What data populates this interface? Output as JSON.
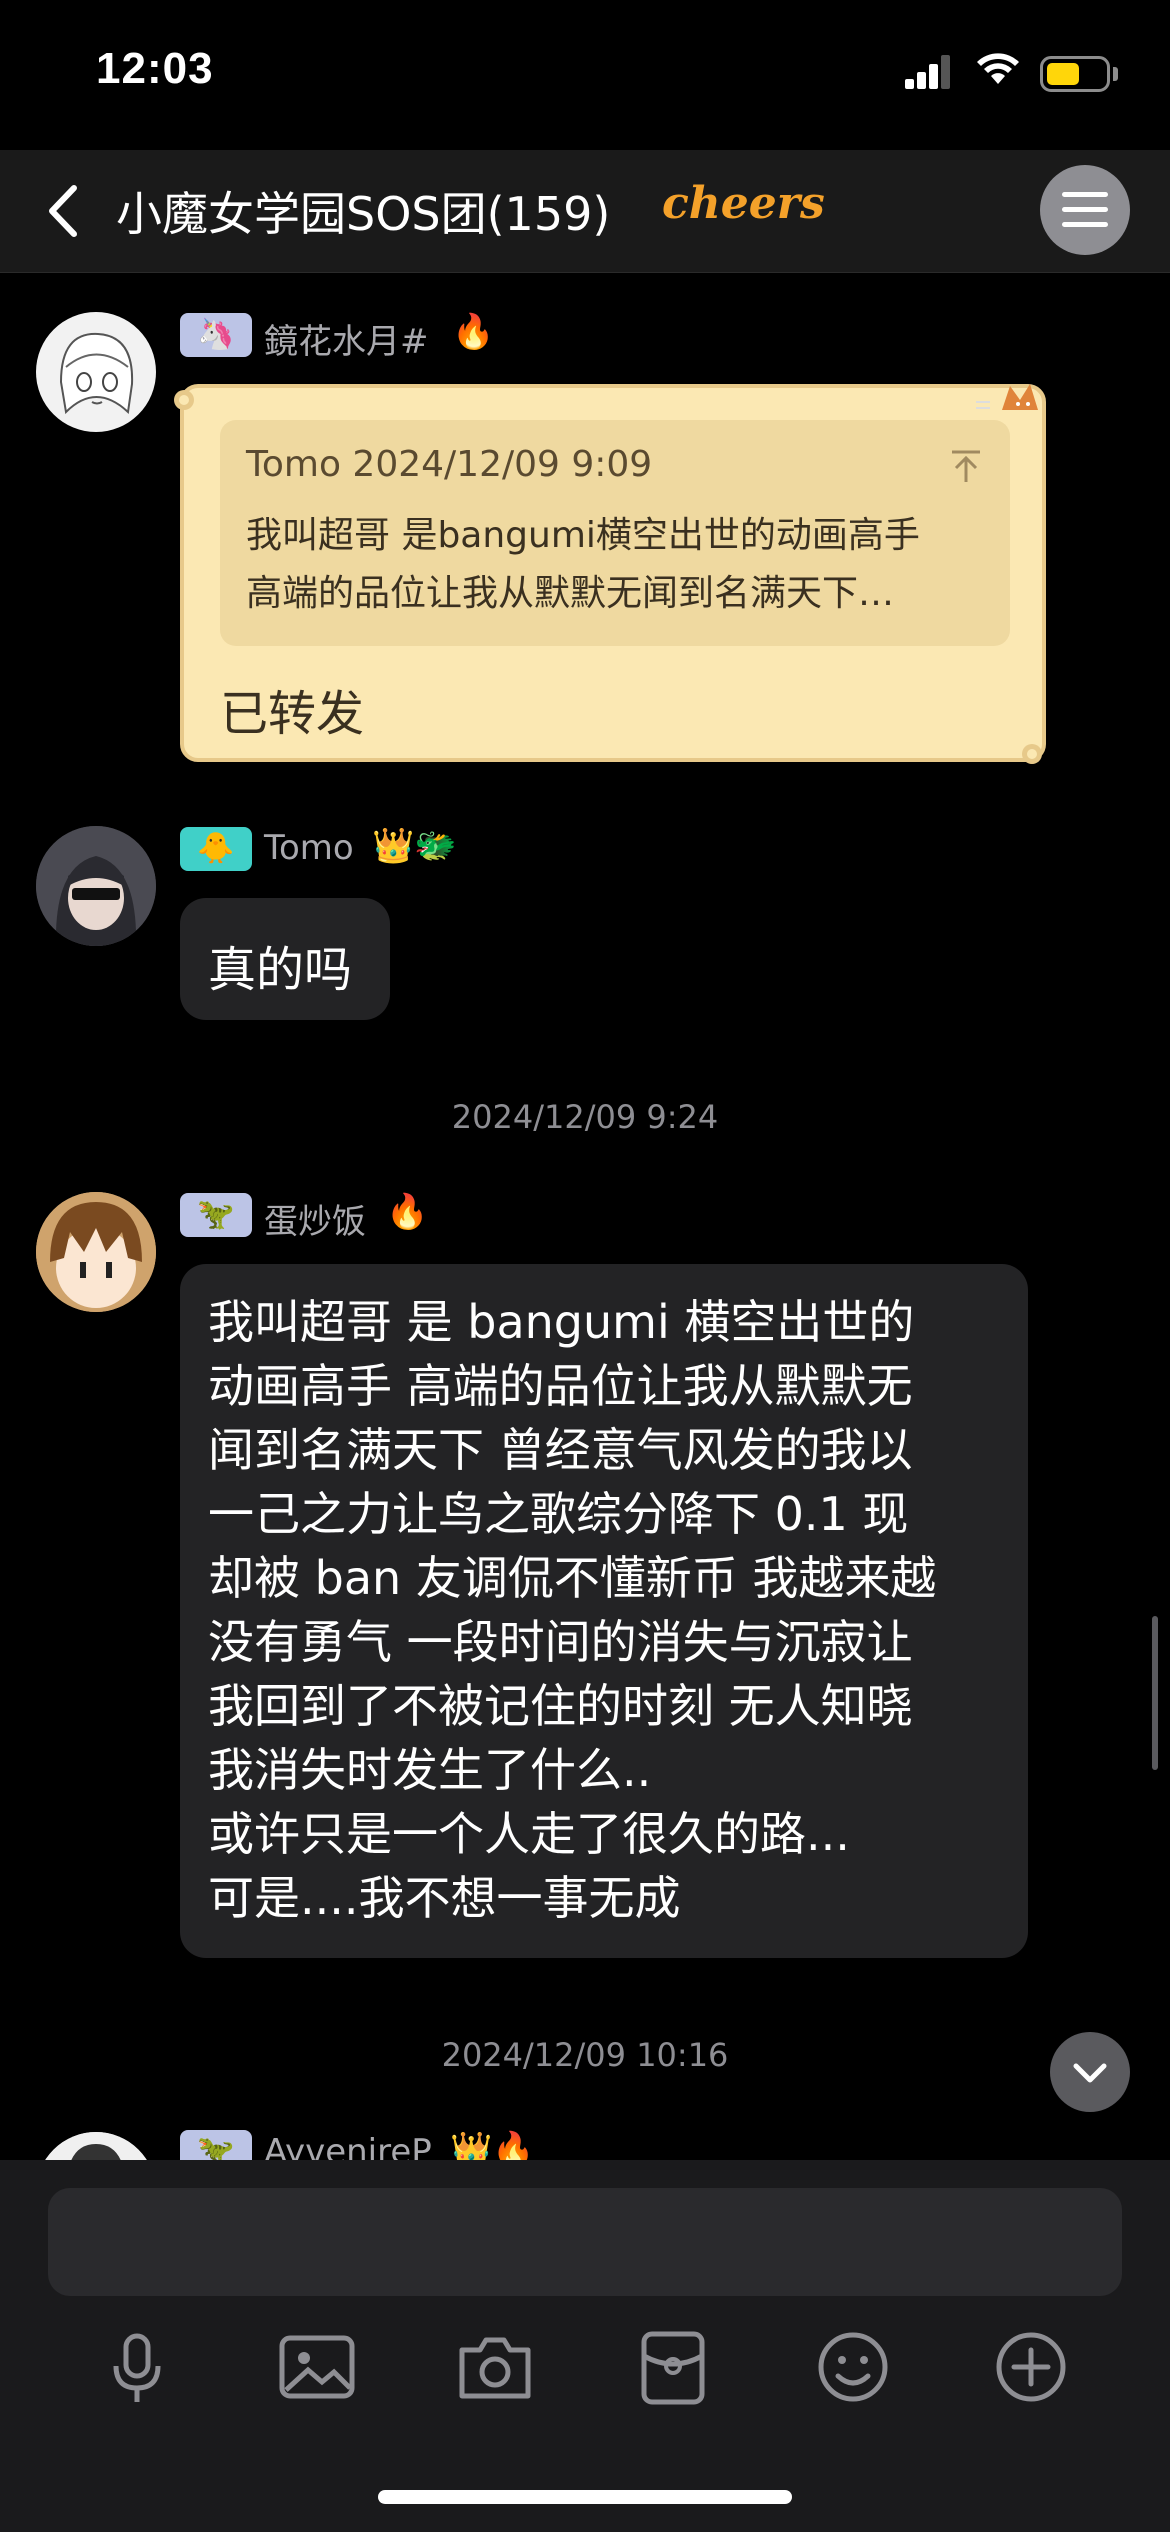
{
  "status_bar": {
    "time": "12:03"
  },
  "header": {
    "title": "小魔女学园SOS团(159)",
    "badge": "cheers"
  },
  "messages": [
    {
      "sender": "鏡花水月#",
      "tag_emoji": "🦄",
      "flair": "🔥",
      "quote": {
        "author_time": "Tomo 2024/12/09 9:09",
        "text_line1": "我叫超哥  是bangumi横空出世的动画高手",
        "text_line2": "高端的品位让我从默默无闻到名满天下…"
      },
      "text": "已转发"
    },
    {
      "sender": "Tomo",
      "tag_emoji": "🐥",
      "flair": "👑🐲",
      "text": "真的吗"
    },
    {
      "timestamp": "2024/12/09 9:24"
    },
    {
      "sender": "蛋炒饭",
      "tag_emoji": "🦖",
      "flair": "🔥",
      "lines": [
        "我叫超哥  是 bangumi 横空出世的",
        "动画高手 高端的品位让我从默默无",
        "闻到名满天下 曾经意气风发的我以",
        "一己之力让鸟之歌综分降下 0.1 现",
        "却被 ban 友调侃不懂新币 我越来越",
        "没有勇气 一段时间的消失与沉寂让",
        "我回到了不被记住的时刻 无人知晓",
        "我消失时发生了什么..",
        "或许只是一个人走了很久的路...",
        "可是....我不想一事无成"
      ]
    },
    {
      "timestamp": "2024/12/09 10:16"
    },
    {
      "sender": "AyvenireP",
      "tag_emoji": "🦖",
      "flair": "👑🔥"
    }
  ],
  "input": {
    "placeholder": ""
  },
  "toolbar": [
    "microphone",
    "image",
    "camera",
    "red-packet",
    "emoji",
    "plus"
  ],
  "colors": {
    "quote_card": "#fbe8b3",
    "bubble": "#232325",
    "accent": "#f4a12a"
  }
}
